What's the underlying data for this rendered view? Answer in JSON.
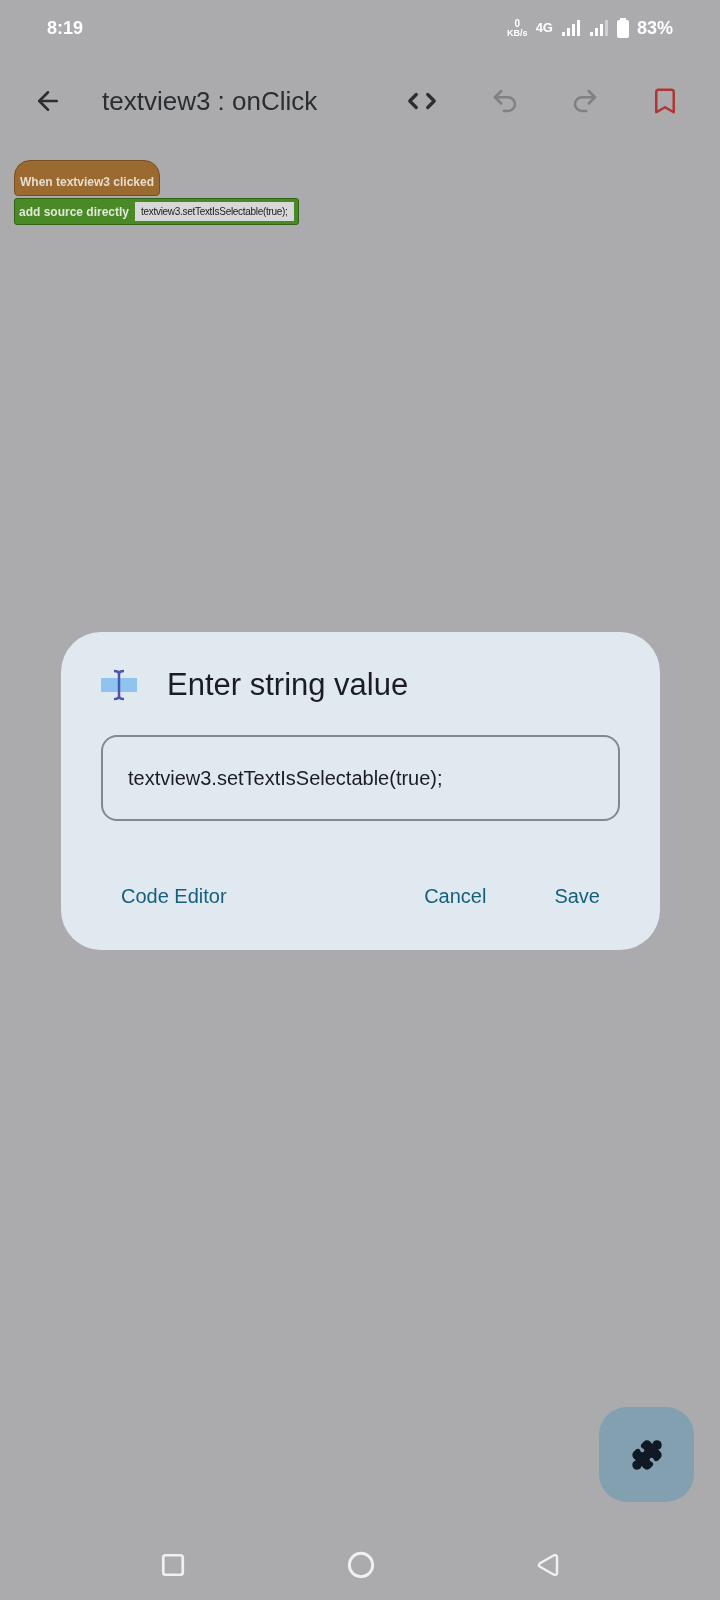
{
  "status_bar": {
    "time": "8:19",
    "speed_value": "0",
    "speed_unit": "KB/s",
    "network": "4G",
    "battery": "83%"
  },
  "toolbar": {
    "title": "textview3 : onClick"
  },
  "blocks": [
    {
      "kind": "event",
      "label": "When textview3 clicked"
    },
    {
      "kind": "source",
      "label": "add source directly",
      "value": "textview3.setTextIsSelectable(true);"
    }
  ],
  "dialog": {
    "title": "Enter string value",
    "value": "textview3.setTextIsSelectable(true);",
    "buttons": [
      {
        "kind": "left",
        "label": "Code Editor"
      },
      {
        "kind": "right",
        "label": "Cancel"
      },
      {
        "kind": "right",
        "label": "Save"
      }
    ]
  }
}
